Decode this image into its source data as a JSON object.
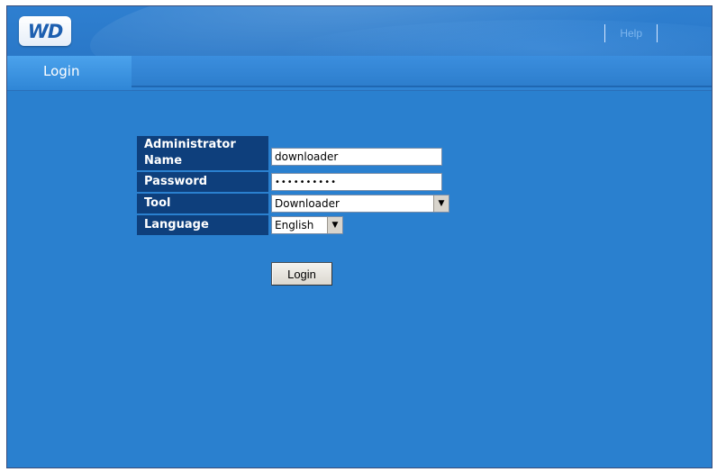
{
  "header": {
    "logo_text": "WD",
    "help_label": "Help"
  },
  "nav": {
    "login_tab": "Login"
  },
  "form": {
    "admin_label": "Administrator Name",
    "admin_value": "downloader",
    "password_label": "Password",
    "password_value": "••••••••••",
    "tool_label": "Tool",
    "tool_value": "Downloader",
    "language_label": "Language",
    "language_value": "English",
    "login_button": "Login"
  },
  "colors": {
    "background": "#2a80cf",
    "label_bg": "#0e3f7c"
  },
  "icons": {
    "dropdown": "chevron-down-icon"
  }
}
